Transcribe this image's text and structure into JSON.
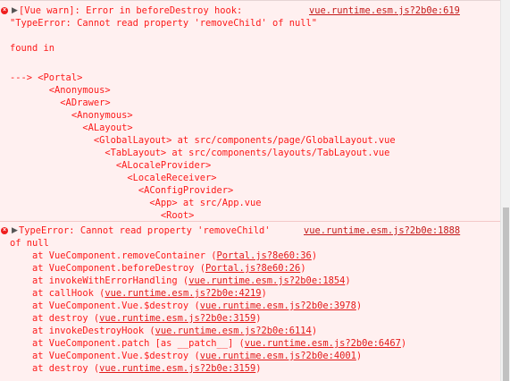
{
  "block1": {
    "header": "[Vue warn]: Error in beforeDestroy hook:",
    "source": "vue.runtime.esm.js?2b0e:619",
    "message": "\"TypeError: Cannot read property 'removeChild' of null\"",
    "found_in": "found in",
    "tree": [
      "---> <Portal>",
      "       <Anonymous>",
      "         <ADrawer>",
      "           <Anonymous>",
      "             <ALayout>",
      "               <GlobalLayout> at src/components/page/GlobalLayout.vue",
      "                 <TabLayout> at src/components/layouts/TabLayout.vue",
      "                   <ALocaleProvider>",
      "                     <LocaleReceiver>",
      "                       <AConfigProvider>",
      "                         <App> at src/App.vue",
      "                           <Root>"
    ]
  },
  "block2": {
    "header": "TypeError: Cannot read property 'removeChild'",
    "header_cont": "of null",
    "source": "vue.runtime.esm.js?2b0e:1888",
    "stack": [
      {
        "prefix": "    at VueComponent.removeContainer (",
        "link": "Portal.js?8e60:36",
        "suffix": ")"
      },
      {
        "prefix": "    at VueComponent.beforeDestroy (",
        "link": "Portal.js?8e60:26",
        "suffix": ")"
      },
      {
        "prefix": "    at invokeWithErrorHandling (",
        "link": "vue.runtime.esm.js?2b0e:1854",
        "suffix": ")"
      },
      {
        "prefix": "    at callHook (",
        "link": "vue.runtime.esm.js?2b0e:4219",
        "suffix": ")"
      },
      {
        "prefix": "    at VueComponent.Vue.$destroy (",
        "link": "vue.runtime.esm.js?2b0e:3978",
        "suffix": ")"
      },
      {
        "prefix": "    at destroy (",
        "link": "vue.runtime.esm.js?2b0e:3159",
        "suffix": ")"
      },
      {
        "prefix": "    at invokeDestroyHook (",
        "link": "vue.runtime.esm.js?2b0e:6114",
        "suffix": ")"
      },
      {
        "prefix": "    at VueComponent.patch [as __patch__] (",
        "link": "vue.runtime.esm.js?2b0e:6467",
        "suffix": ")"
      },
      {
        "prefix": "    at VueComponent.Vue.$destroy (",
        "link": "vue.runtime.esm.js?2b0e:4001",
        "suffix": ")"
      },
      {
        "prefix": "    at destroy (",
        "link": "vue.runtime.esm.js?2b0e:3159",
        "suffix": ")"
      }
    ]
  },
  "icons": {
    "error": "error-circle-icon",
    "expand": "expand-triangle-icon"
  },
  "colors": {
    "background": "#fff0f0",
    "text": "#fc1a1a",
    "link": "#c41a1a"
  }
}
